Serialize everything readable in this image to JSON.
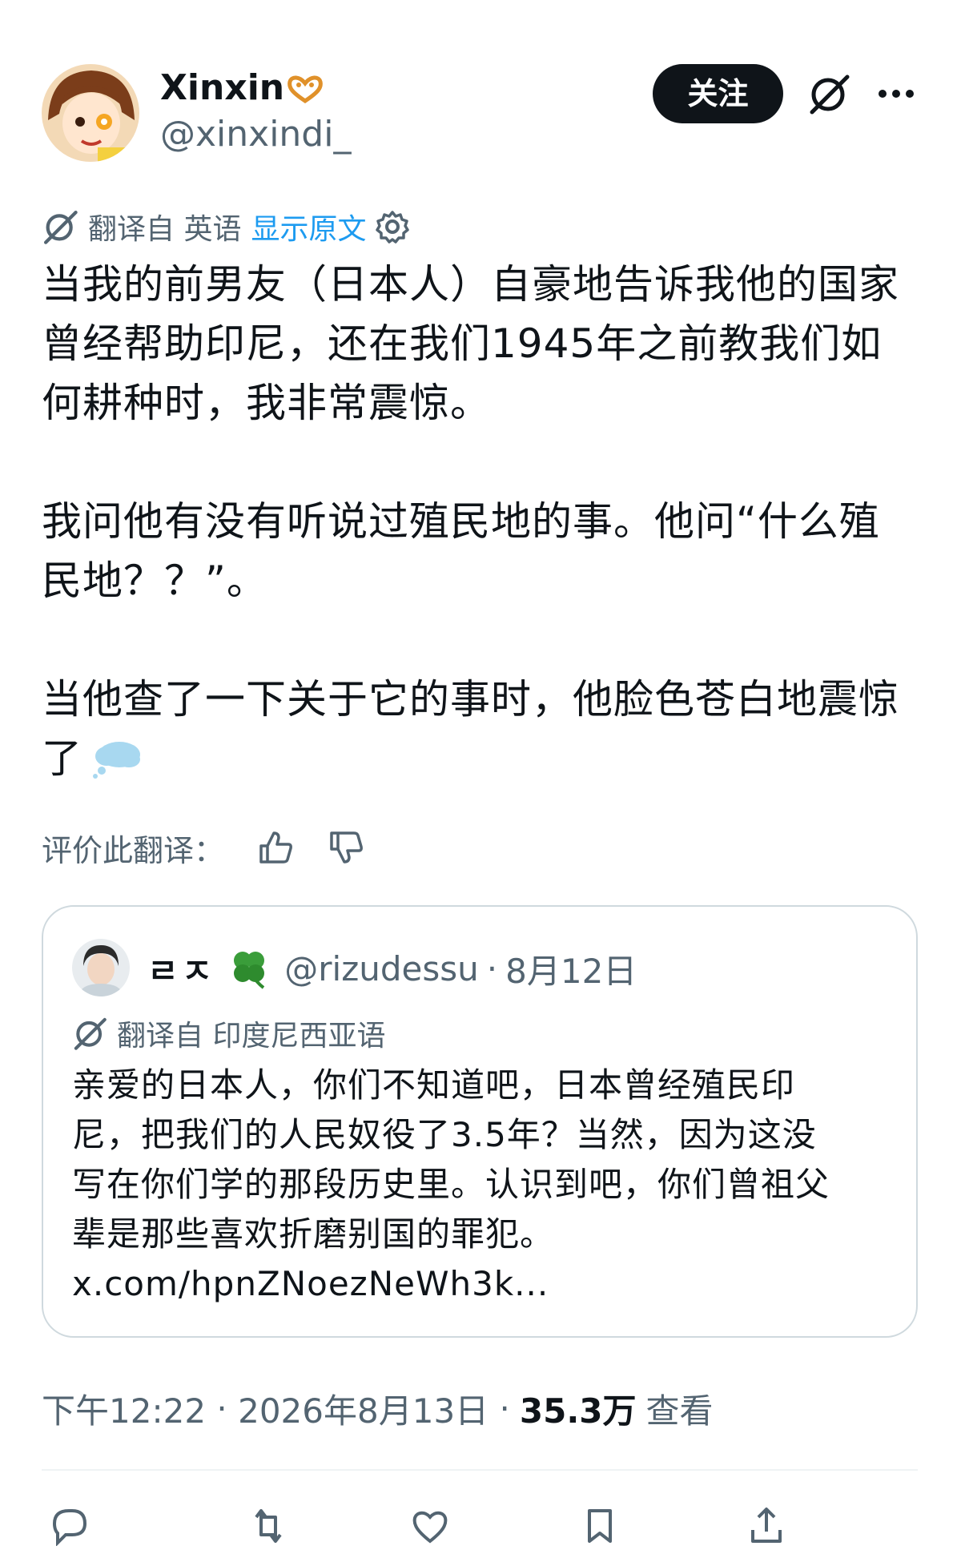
{
  "header": {
    "display_name": "Xinxin",
    "handle": "@xinxindi_",
    "follow_label": "关注",
    "verified_icon": "pretzel-badge-icon",
    "grok_icon": "grok-icon",
    "more_icon": "more-icon"
  },
  "translation": {
    "prefix": "翻译自 英语",
    "show_original": "显示原文"
  },
  "tweet": {
    "paragraph1": "当我的前男友（日本人）自豪地告诉我他的国家\n曾经帮助印尼，还在我们1945年之前教我们如\n何耕种时，我非常震惊。",
    "paragraph2": "我问他有没有听说过殖民地的事。他问“什么殖\n民地？？”。",
    "paragraph3": "当他查了一下关于它的事时，他脸色苍白地震惊\n了"
  },
  "rate": {
    "label": "评价此翻译："
  },
  "quote": {
    "name": "ㄹㅈ",
    "handle": "@rizudessu",
    "date": "8月12日",
    "translation_label": "翻译自 印度尼西亚语",
    "text": "亲爱的日本人，你们不知道吧，日本曾经殖民印\n尼，把我们的人民奴役了3.5年？当然，因为这没\n写在你们学的那段历史里。认识到吧，你们曾祖父\n辈是那些喜欢折磨别国的罪犯。\nx.com/hpnZNoezNeWh3k..."
  },
  "meta": {
    "time": "下午12:22",
    "date": "2026年8月13日",
    "views_count": "35.3万",
    "views_label": "查看"
  },
  "colors": {
    "text": "#0f1419",
    "secondary": "#536471",
    "link": "#1d9bf0",
    "border": "#cfd9de"
  }
}
